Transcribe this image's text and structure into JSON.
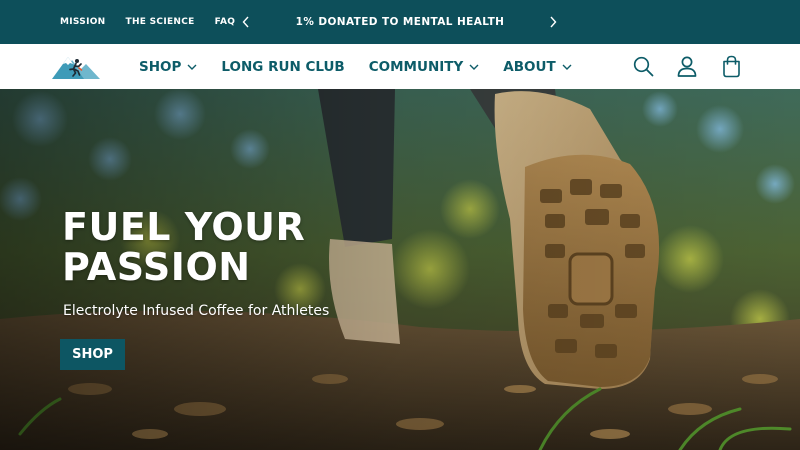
{
  "colors": {
    "teal_dark": "#0d4f5a",
    "teal_brand": "#0d5c68",
    "button_bg": "#0d5663",
    "white": "#ffffff"
  },
  "announcement_bar": {
    "links": [
      {
        "label": "MISSION",
        "icon": null
      },
      {
        "label": "THE SCIENCE",
        "icon": null
      },
      {
        "label": "FAQ",
        "icon": null
      }
    ],
    "prev_icon": "chevron-left-icon",
    "next_icon": "chevron-right-icon",
    "message": "1% DONATED TO MENTAL HEALTH"
  },
  "header": {
    "logo_icon": "mountain-runner-logo",
    "nav": [
      {
        "label": "SHOP",
        "has_dropdown": true
      },
      {
        "label": "LONG RUN CLUB",
        "has_dropdown": false
      },
      {
        "label": "COMMUNITY",
        "has_dropdown": true
      },
      {
        "label": "ABOUT",
        "has_dropdown": true
      }
    ],
    "icons": [
      "search-icon",
      "account-icon",
      "cart-icon"
    ]
  },
  "hero": {
    "title_line1": "FUEL YOUR",
    "title_line2": "PASSION",
    "subtitle": "Electrolyte Infused Coffee for Athletes",
    "button_label": "SHOP"
  }
}
